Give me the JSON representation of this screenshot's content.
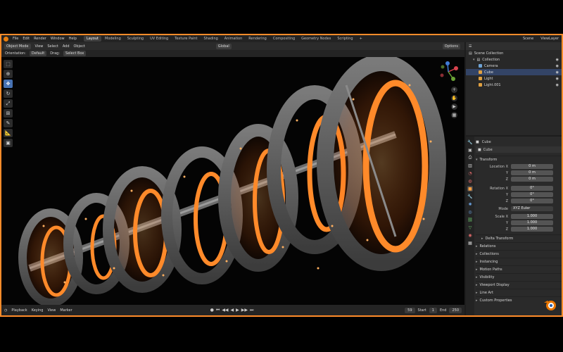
{
  "menubar": {
    "menus": [
      "File",
      "Edit",
      "Render",
      "Window",
      "Help"
    ],
    "workspaces": [
      "Layout",
      "Modeling",
      "Sculpting",
      "UV Editing",
      "Texture Paint",
      "Shading",
      "Animation",
      "Rendering",
      "Compositing",
      "Geometry Nodes",
      "Scripting"
    ],
    "add": "+",
    "scene": "Scene",
    "view_layer": "ViewLayer"
  },
  "viewport_header": {
    "mode": "Object Mode",
    "menus": [
      "View",
      "Select",
      "Add",
      "Object"
    ],
    "transform": "Global",
    "orientation_label": "Orientation:",
    "orientation_value": "Default",
    "drag_label": "Drag:",
    "drag_value": "Select Box",
    "options": "Options"
  },
  "timeline": {
    "menus": [
      "Playback",
      "Keying",
      "View",
      "Marker"
    ],
    "current_frame": "59",
    "start_label": "Start",
    "start_value": "1",
    "end_label": "End",
    "end_value": "250"
  },
  "outliner": {
    "root": "Scene Collection",
    "collection": "Collection",
    "items": [
      {
        "name": "Camera",
        "color": "#6ea3d6"
      },
      {
        "name": "Cube",
        "color": "#e0a040"
      },
      {
        "name": "Light",
        "color": "#e0a040"
      },
      {
        "name": "Light.001",
        "color": "#e0a040"
      }
    ]
  },
  "properties": {
    "object_name": "Cube",
    "object_field": "Cube",
    "transform_header": "Transform",
    "location_label": "Location X",
    "location": [
      "0 m",
      "0 m",
      "0 m"
    ],
    "rotation_label": "Rotation X",
    "rotation": [
      "0°",
      "0°",
      "0°"
    ],
    "mode_label": "Mode",
    "mode_value": "XYZ Euler",
    "scale_label": "Scale X",
    "scale": [
      "1.000",
      "1.000",
      "1.000"
    ],
    "axis_y": "Y",
    "axis_z": "Z",
    "delta": "Delta Transform",
    "sections": [
      "Relations",
      "Collections",
      "Instancing",
      "Motion Paths",
      "Visibility",
      "Viewport Display",
      "Line Art",
      "Custom Properties"
    ]
  },
  "colors": {
    "frame": "#ff8c2a",
    "accent": "#4772b3",
    "glow": "#ff7a1a"
  }
}
